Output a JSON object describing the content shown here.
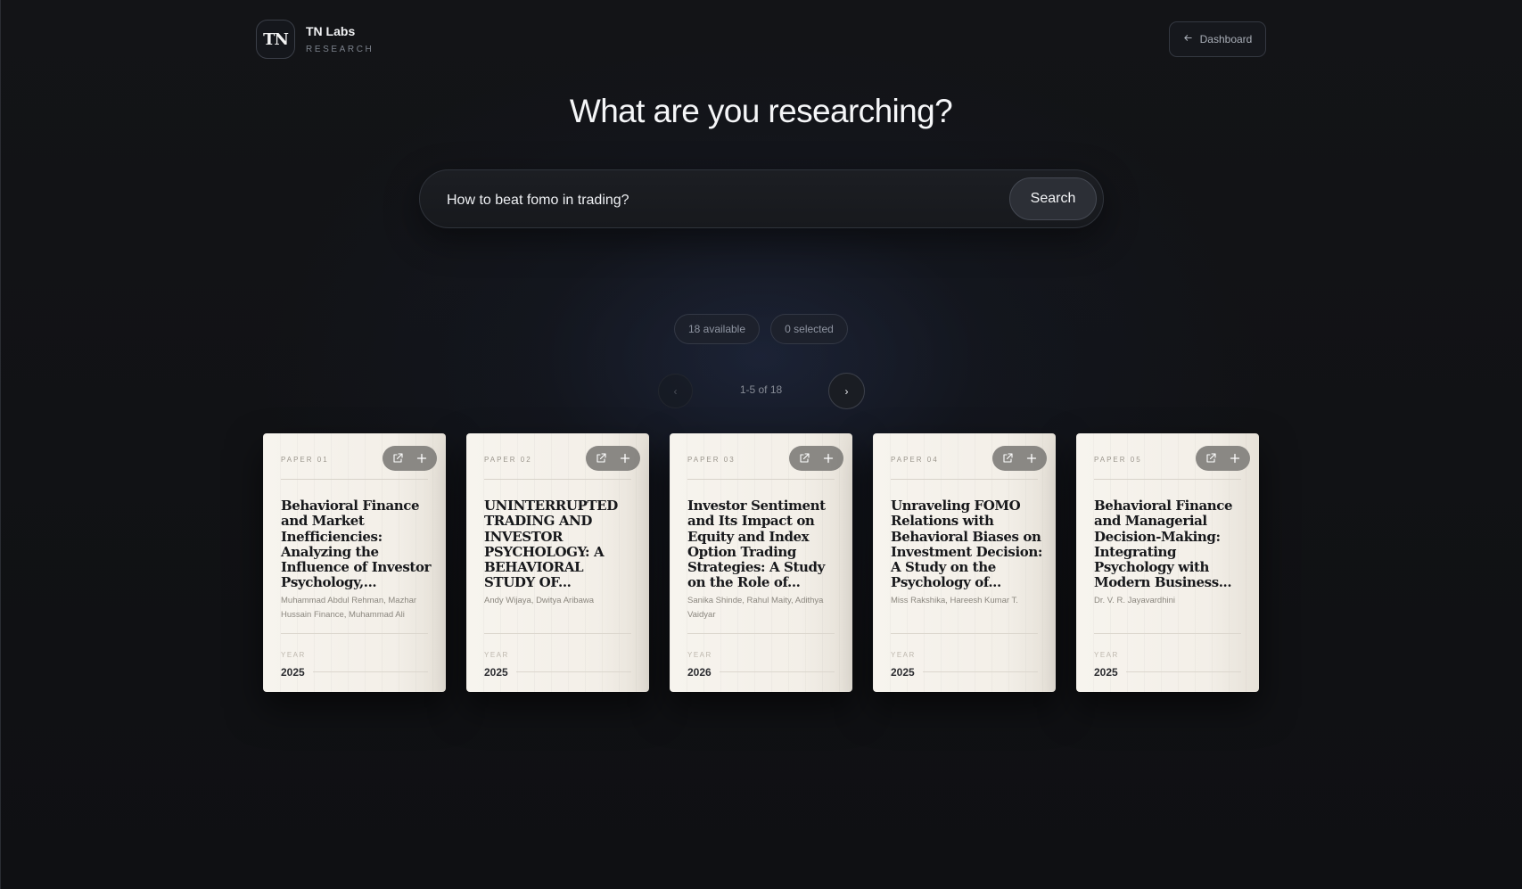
{
  "brand": {
    "logo_text": "TN",
    "name": "TN Labs",
    "subtitle": "RESEARCH"
  },
  "nav": {
    "dashboard_label": "Dashboard"
  },
  "hero": {
    "heading": "What are you researching?"
  },
  "search": {
    "value": "How to beat fomo in trading?",
    "button_label": "Search"
  },
  "stats": {
    "available": "18 available",
    "selected": "0 selected"
  },
  "pager": {
    "prev_label": "‹",
    "next_label": "›",
    "range_label": "1-5 of 18"
  },
  "cards": [
    {
      "number": "PAPER 01",
      "title": "Behavioral Finance and Market Inefficiencies: Analyzing the Influence of Investor Psychology,...",
      "authors": "Muhammad Abdul Rehman, Mazhar Hussain Finance, Muhammad Ali",
      "year_label": "YEAR",
      "year": "2025"
    },
    {
      "number": "PAPER 02",
      "title": "UNINTERRUPTED TRADING AND INVESTOR PSYCHOLOGY: A BEHAVIORAL STUDY OF...",
      "authors": "Andy Wijaya, Dwitya Aribawa",
      "year_label": "YEAR",
      "year": "2025"
    },
    {
      "number": "PAPER 03",
      "title": "Investor Sentiment and Its Impact on Equity and Index Option Trading Strategies: A Study on the Role of...",
      "authors": "Sanika Shinde, Rahul Maity, Adithya Vaidyar",
      "year_label": "YEAR",
      "year": "2026"
    },
    {
      "number": "PAPER 04",
      "title": "Unraveling FOMO Relations with Behavioral Biases on Investment Decision: A Study on the Psychology of...",
      "authors": "Miss Rakshika, Hareesh Kumar T.",
      "year_label": "YEAR",
      "year": "2025"
    },
    {
      "number": "PAPER 05",
      "title": "Behavioral Finance and Managerial Decision-Making: Integrating Psychology with Modern Business...",
      "authors": "Dr. V. R. Jayavardhini",
      "year_label": "YEAR",
      "year": "2025"
    }
  ]
}
